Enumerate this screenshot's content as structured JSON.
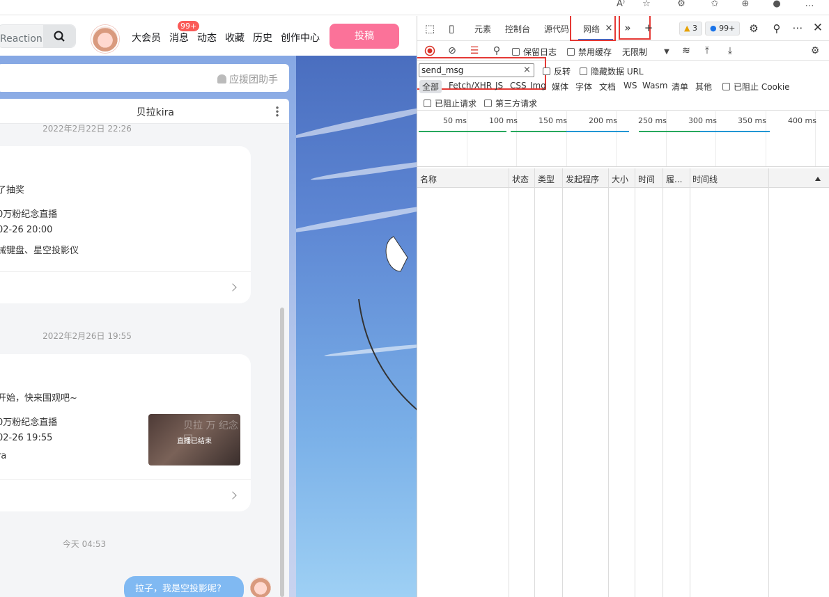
{
  "browser": {
    "icons": [
      "read-aloud-icon",
      "add-favorite-icon",
      "extensions-icon",
      "favorites-icon",
      "collections-icon",
      "profile-icon",
      "more-icon"
    ]
  },
  "site": {
    "search_text": "Reaction看",
    "nav": [
      "大会员",
      "消息",
      "动态",
      "收藏",
      "历史",
      "创作中心"
    ],
    "msg_badge": "99+",
    "post_button": "投稿",
    "assistant_label": "应援团助手"
  },
  "chat": {
    "title": "贝拉kira",
    "messages": [
      {
        "time": "2022年2月22日 22:26",
        "lines": [
          "了抽奖",
          "0万粉纪念直播",
          "02-26 20:00",
          "械键盘、星空投影仪"
        ]
      },
      {
        "time": "2022年2月26日 19:55",
        "lines": [
          "开始，快来围观吧~",
          "0万粉纪念直播",
          "02-26 19:55",
          "ra"
        ],
        "thumb_label": "直播已结束",
        "thumb_watermark": "贝拉 万 纪念回"
      }
    ],
    "my_time": "今天 04:53",
    "my_message": "拉子，我是空投影呢?"
  },
  "devtools": {
    "tabs": [
      "元素",
      "控制台",
      "源代码",
      "网络"
    ],
    "warnings": "3",
    "messages": "99+",
    "toolbar": {
      "preserve_log": "保留日志",
      "disable_cache": "禁用缓存",
      "throttle": "无限制"
    },
    "filter": {
      "value": "send_msg",
      "invert": "反转",
      "hide_data_urls": "隐藏数据 URL",
      "types": [
        "全部",
        "Fetch/XHR",
        "JS",
        "CSS",
        "Img",
        "媒体",
        "字体",
        "文档",
        "WS",
        "Wasm",
        "清单",
        "其他"
      ],
      "blocked_cookies": "已阻止 Cookie",
      "blocked_requests": "已阻止请求",
      "third_party": "第三方请求"
    },
    "timeline_labels": [
      "50 ms",
      "100 ms",
      "150 ms",
      "200 ms",
      "250 ms",
      "300 ms",
      "350 ms",
      "400 ms"
    ],
    "columns": [
      "名称",
      "状态",
      "类型",
      "发起程序",
      "大小",
      "时间",
      "履...",
      "时间线"
    ]
  }
}
